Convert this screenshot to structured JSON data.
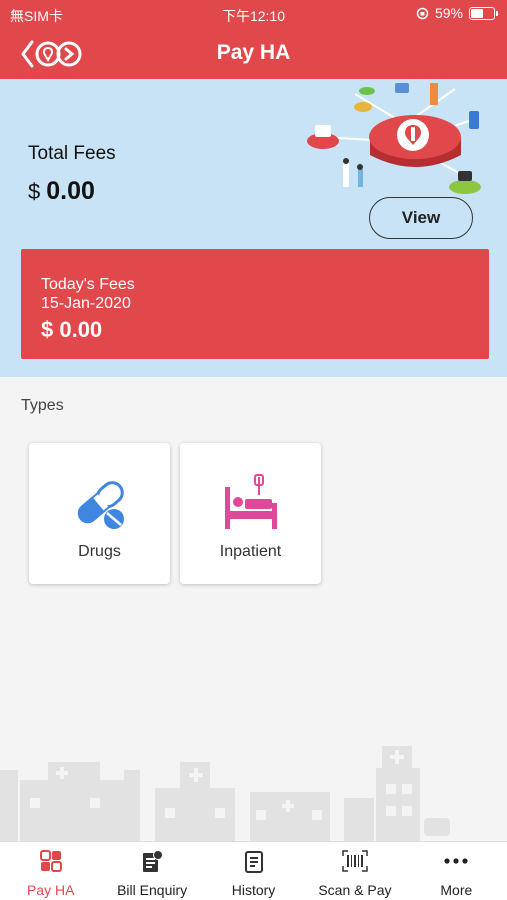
{
  "status_bar": {
    "carrier": "無SIM卡",
    "time": "下午12:10",
    "battery": "59%",
    "battery_level": 0.59
  },
  "header": {
    "title": "Pay HA",
    "back_icon": "chevron-left-icon",
    "logo_icon": "ha-go-logo-icon"
  },
  "summary": {
    "total_label": "Total Fees",
    "currency": "$",
    "total_amount": "0.00",
    "view_label": "View",
    "today": {
      "label": "Today's Fees",
      "date": "15-Jan-2020",
      "amount": "$ 0.00"
    }
  },
  "types": {
    "label": "Types",
    "items": [
      {
        "label": "Drugs",
        "icon": "pill-icon",
        "color": "#3f86e0"
      },
      {
        "label": "Inpatient",
        "icon": "hospital-bed-icon",
        "color": "#e0489a"
      }
    ]
  },
  "tabs": [
    {
      "label": "Pay HA",
      "icon": "pay-ha-icon",
      "active": true
    },
    {
      "label": "Bill Enquiry",
      "icon": "bill-enquiry-icon",
      "active": false
    },
    {
      "label": "History",
      "icon": "history-icon",
      "active": false
    },
    {
      "label": "Scan & Pay",
      "icon": "barcode-scan-icon",
      "active": false
    },
    {
      "label": "More",
      "icon": "more-dots-icon",
      "active": false
    }
  ],
  "colors": {
    "brand": "#e0484b",
    "summary_bg": "#c8e3f6",
    "page_bg": "#f4f4f4"
  }
}
